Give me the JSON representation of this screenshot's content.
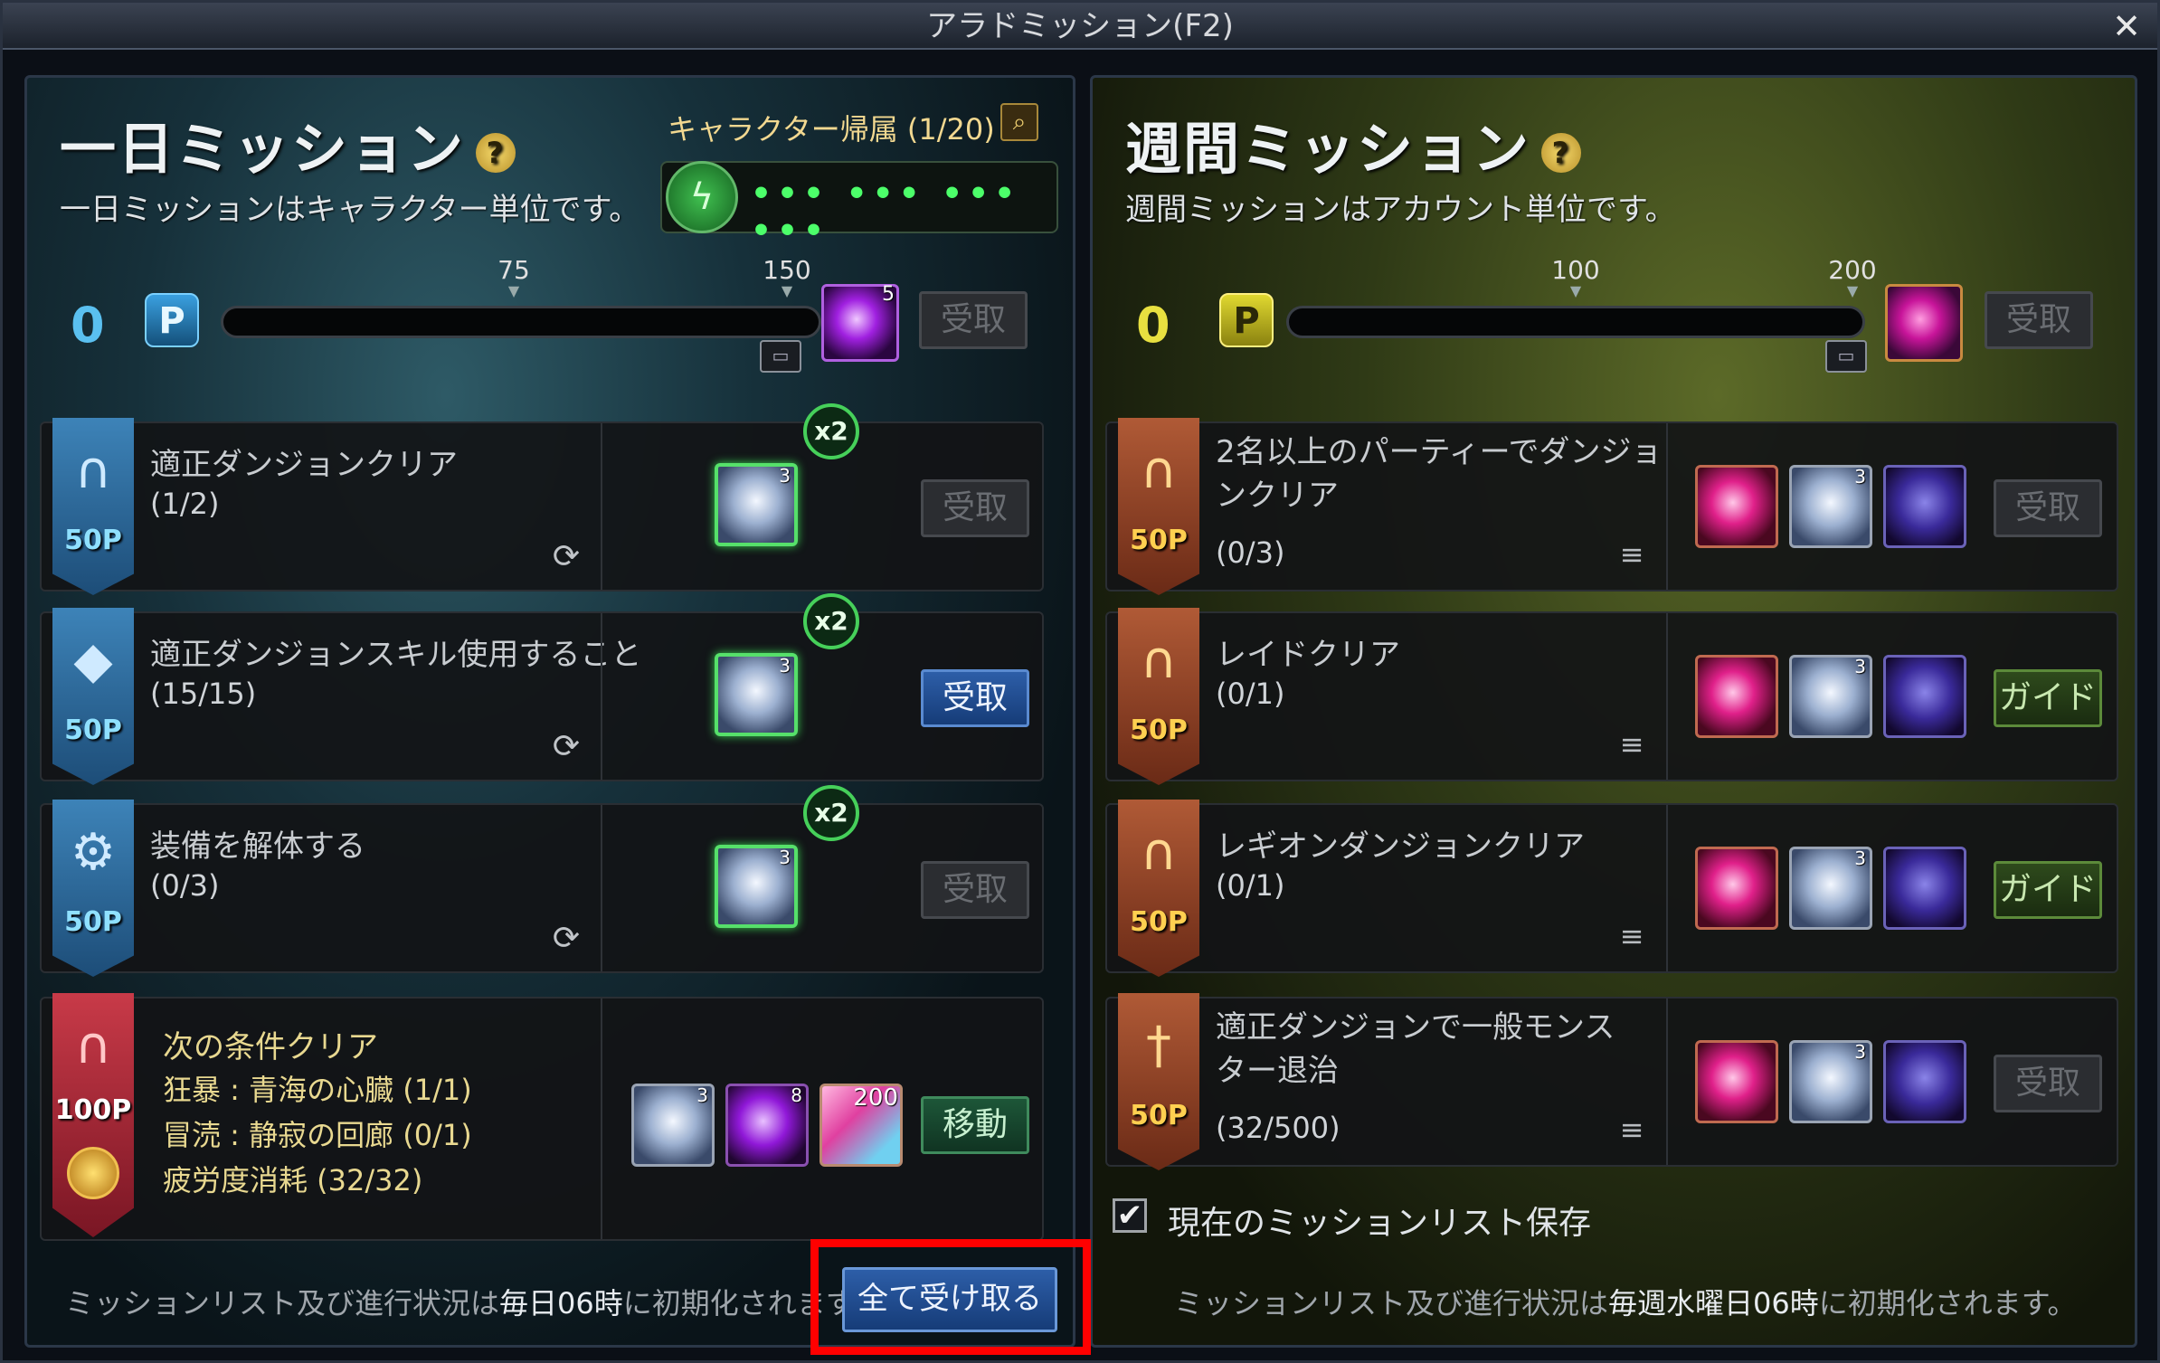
{
  "window": {
    "title": "アラドミッション(F2)",
    "close_glyph": "✕"
  },
  "daily": {
    "title": "一日ミッション",
    "subtitle": "一日ミッションはキャラクター単位です。",
    "char_label": "キャラクター帰属 (1/20)",
    "fatigue_dots": "••• ••• ••• •••",
    "points": "0",
    "point_badge": "P",
    "milestones": [
      "75",
      "150"
    ],
    "reward_count": "5",
    "claim_label": "受取",
    "missions": [
      {
        "title": "適正ダンジョンクリア",
        "progress": "(1/2)",
        "points": "50P",
        "icon": "gate-icon",
        "reward_count": "3",
        "multiplier": "x2",
        "button": "受取",
        "button_state": "disabled"
      },
      {
        "title": "適正ダンジョンスキル使用すること",
        "progress": "(15/15)",
        "points": "50P",
        "icon": "crystal-icon",
        "reward_count": "3",
        "multiplier": "x2",
        "button": "受取",
        "button_state": "active"
      },
      {
        "title": "装備を解体する",
        "progress": "(0/3)",
        "points": "50P",
        "icon": "gear-icon",
        "reward_count": "3",
        "multiplier": "x2",
        "button": "受取",
        "button_state": "disabled"
      }
    ],
    "special": {
      "title": "次の条件クリア",
      "lines": [
        "狂暴 : 青海の心臓 (1/1)",
        "冒涜 : 静寂の回廊 (0/1)",
        "疲労度消耗 (32/32)"
      ],
      "points": "100P",
      "rewards": [
        {
          "type": "gear",
          "count": "3"
        },
        {
          "type": "purple",
          "count": "8"
        },
        {
          "type": "gem",
          "count": "200"
        }
      ],
      "button": "移動"
    },
    "footnote_a": "ミッションリスト及び進行状況は",
    "footnote_b": "毎日06時",
    "footnote_c": "に初期化されます",
    "claim_all": "全て受け取る"
  },
  "weekly": {
    "title": "週間ミッション",
    "subtitle": "週間ミッションはアカウント単位です。",
    "points": "0",
    "point_badge": "P",
    "milestones": [
      "100",
      "200"
    ],
    "claim_label": "受取",
    "missions": [
      {
        "title": "2名以上のパーティーでダンジョンクリア",
        "progress": "(0/3)",
        "points": "50P",
        "button": "受取",
        "button_state": "disabled"
      },
      {
        "title": "レイドクリア",
        "progress": "(0/1)",
        "points": "50P",
        "button": "ガイド",
        "button_state": "guide"
      },
      {
        "title": "レギオンダンジョンクリア",
        "progress": "(0/1)",
        "points": "50P",
        "button": "ガイド",
        "button_state": "guide"
      },
      {
        "title": "適正ダンジョンで一般モンスター退治",
        "progress": "(32/500)",
        "points": "50P",
        "button": "受取",
        "button_state": "disabled"
      }
    ],
    "reward_gear_count": "3",
    "save_label": "現在のミッションリスト保存",
    "save_checked": "✔",
    "footnote_a": "ミッションリスト及び進行状況は",
    "footnote_b": "毎週水曜日06時",
    "footnote_c": "に初期化されます。"
  },
  "colors": {
    "daily_accent": "#4aa8e0",
    "weekly_accent": "#d8d030",
    "highlight": "#ff0000",
    "x2_ring": "#46d05a"
  }
}
